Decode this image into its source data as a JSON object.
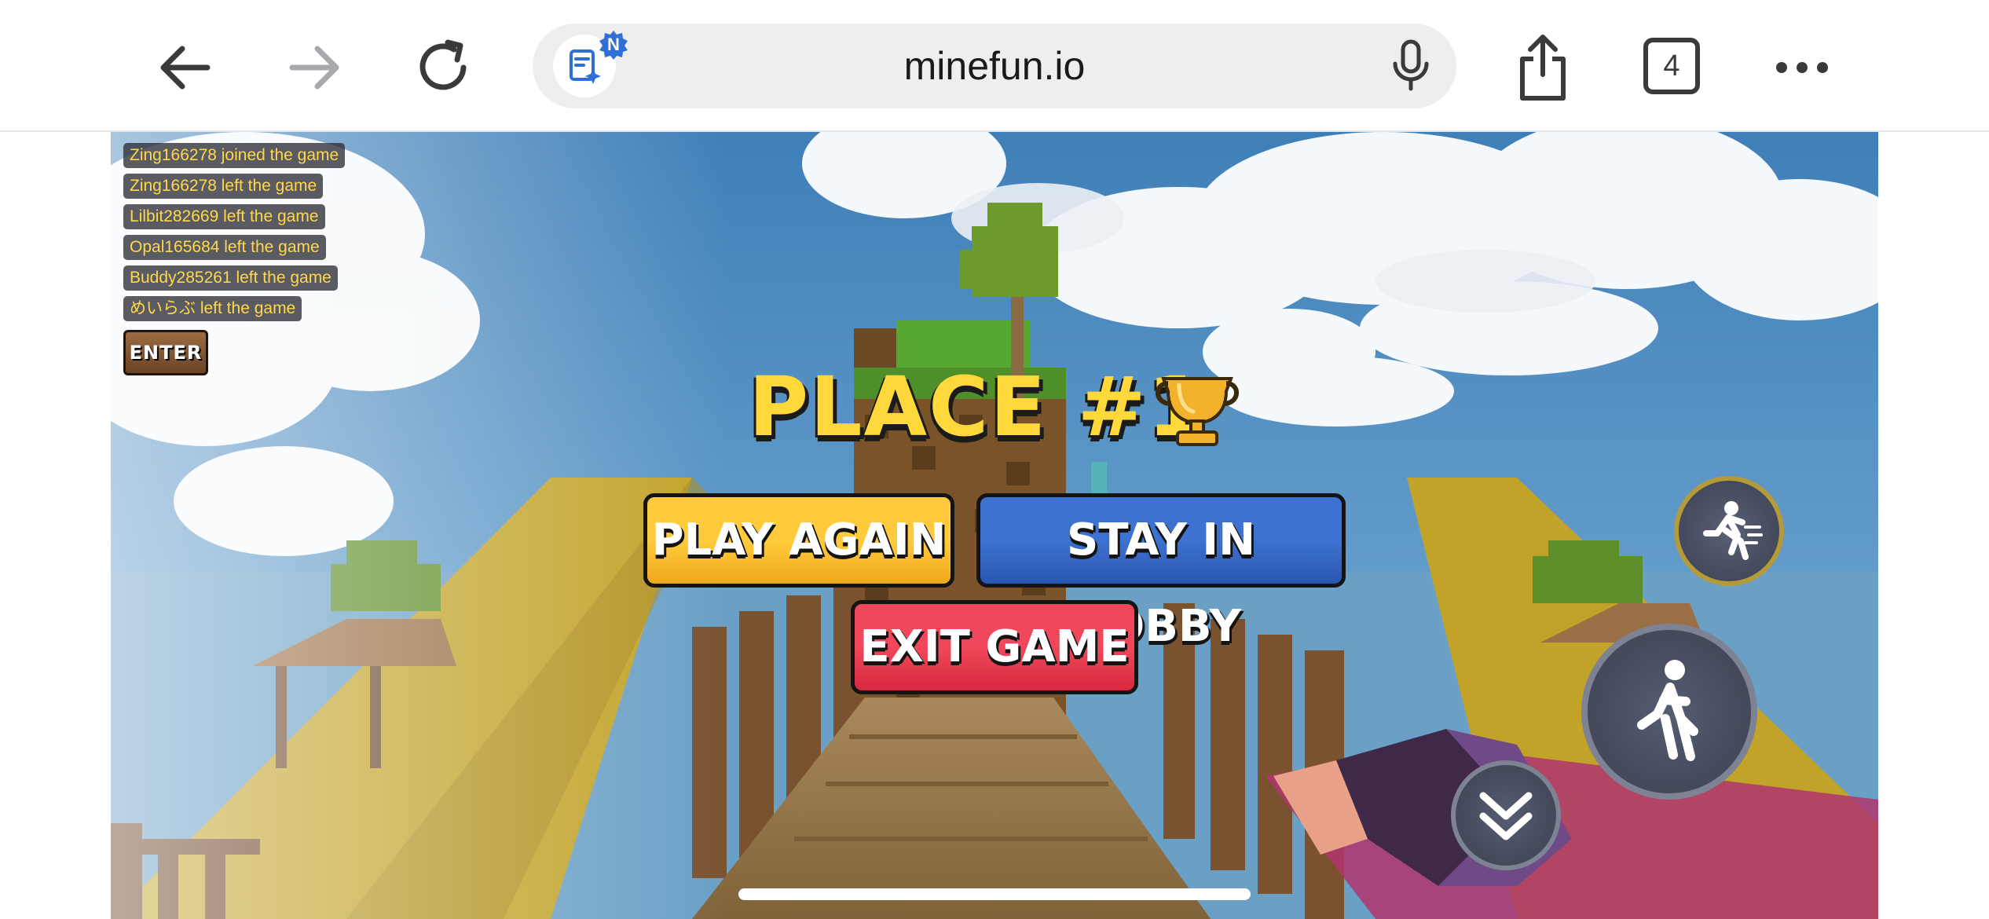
{
  "browser": {
    "url": "minefun.io",
    "ai_badge": "N",
    "tab_count": "4",
    "icons": [
      "back-arrow-icon",
      "forward-arrow-icon",
      "reload-icon",
      "ai-assistant-icon",
      "microphone-icon",
      "share-icon",
      "tabs-icon",
      "more-icon"
    ]
  },
  "game": {
    "chat": [
      "Zing166278 joined the game",
      "Zing166278 left the game",
      "Lilbit282669 left the game",
      "Opal165684 left the game",
      "Buddy285261 left the game",
      "めいらぶ left the game"
    ],
    "enter_label": "ENTER",
    "place_title": "PLACE #1",
    "play_again_label": "PLAY AGAIN",
    "stay_in_lobby_label": "STAY IN LOBBY",
    "exit_game_label": "EXIT GAME",
    "controls": [
      "sprint-icon",
      "jump-icon",
      "crouch-icon"
    ]
  },
  "colors": {
    "title_yellow": "#ffd93b",
    "play_again": "#ffcb3d",
    "stay_in_lobby": "#3d72d0",
    "exit_game": "#f0485a",
    "chat_text": "#ffd84a"
  }
}
